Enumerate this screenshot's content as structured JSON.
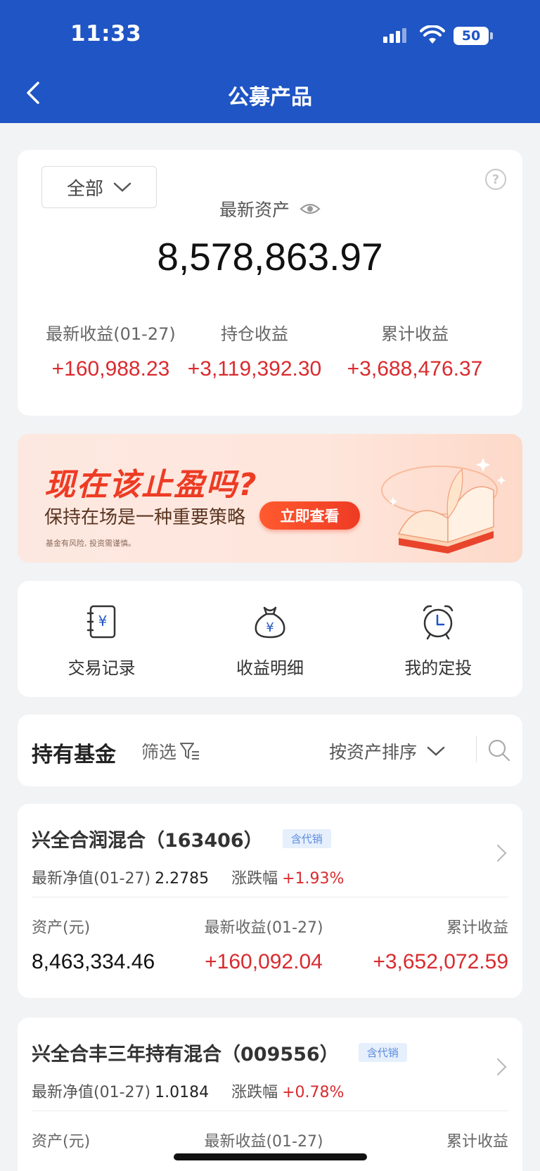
{
  "status_bar": {
    "time": "11:33",
    "battery": "50"
  },
  "header": {
    "title": "公募产品"
  },
  "asset_summary": {
    "filter_label": "全部",
    "asset_label": "最新资产",
    "asset_value": "8,578,863.97",
    "stats": [
      {
        "label": "最新收益(01-27)",
        "value": "+160,988.23"
      },
      {
        "label": "持仓收益",
        "value": "+3,119,392.30"
      },
      {
        "label": "累计收益",
        "value": "+3,688,476.37"
      }
    ]
  },
  "banner": {
    "title": "现在该止盈吗?",
    "subtitle": "保持在场是一种重要策略",
    "button": "立即查看",
    "note": "基金有风险, 投资需谨慎。"
  },
  "shortcuts": [
    {
      "label": "交易记录",
      "icon": "ledger-yuan-icon"
    },
    {
      "label": "收益明细",
      "icon": "money-bag-yuan-icon"
    },
    {
      "label": "我的定投",
      "icon": "alarm-clock-icon"
    }
  ],
  "holdings": {
    "title": "持有基金",
    "filter_label": "筛选",
    "sort_label": "按资产排序"
  },
  "funds": [
    {
      "name": "兴全合润混合（163406）",
      "tag": "含代销",
      "nav_label": "最新净值(01-27)",
      "nav": "2.2785",
      "change_label": "涨跌幅",
      "change": "+1.93%",
      "asset_label": "资产(元)",
      "asset": "8,463,334.46",
      "daily_label": "最新收益(01-27)",
      "daily": "+160,092.04",
      "total_label": "累计收益",
      "total": "+3,652,072.59"
    },
    {
      "name": "兴全合丰三年持有混合（009556）",
      "tag": "含代销",
      "nav_label": "最新净值(01-27)",
      "nav": "1.0184",
      "change_label": "涨跌幅",
      "change": "+0.78%",
      "asset_label": "资产(元)",
      "daily_label": "最新收益(01-27)",
      "total_label": "累计收益"
    }
  ],
  "colors": {
    "brand": "#1f55c4",
    "gain": "#d92b2f",
    "banner_accent": "#ee3b24"
  }
}
